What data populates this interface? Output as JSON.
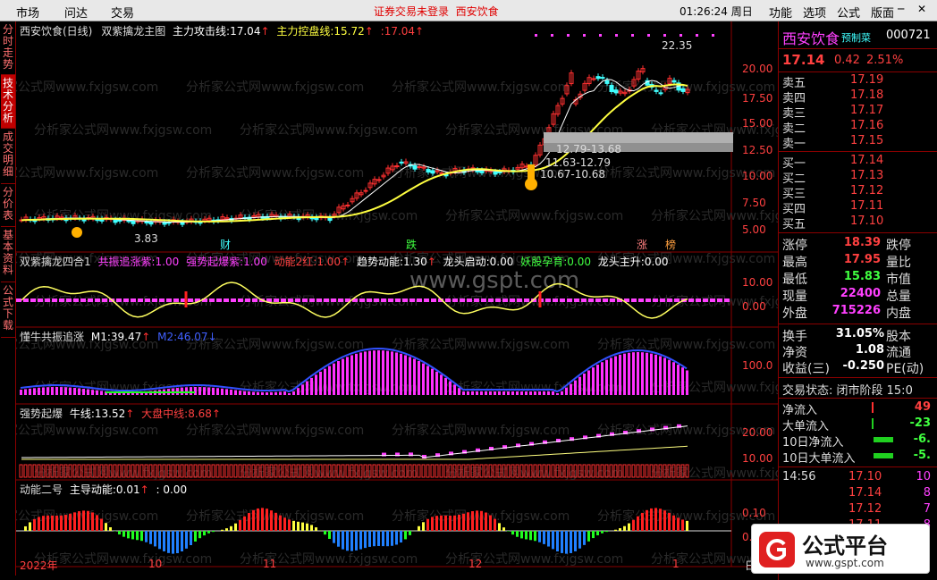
{
  "menubar": {
    "left": [
      "市场",
      "问达",
      "交易"
    ],
    "status": "证券交易未登录",
    "stock": "西安饮食",
    "clock": "01:26:24 周日",
    "right": [
      "功能",
      "选项",
      "公式",
      "版面"
    ],
    "window_buttons": [
      "─",
      "✕"
    ]
  },
  "left_tabs": [
    "分时走势",
    "技术分析",
    "成交明细",
    "分价表",
    "基本资料",
    "公式下载"
  ],
  "panels": {
    "p1": {
      "title": "西安饮食(日线)",
      "ind": "双紫擒龙主图",
      "l1": "主力攻击线:",
      "v1": "17.04",
      "l2": "主力控盘线:",
      "v2": "15.72",
      "v3": "17.04"
    },
    "p2": {
      "ind": "双紫擒龙四合1",
      "l1": "共振追涨紫:",
      "v1": "1.00",
      "l2": "强势起爆紫:",
      "v2": "1.00",
      "l3": "动能2红:",
      "v3": "1.00",
      "l4": "趋势动能:",
      "v4": "1.30",
      "l5": "龙头启动:",
      "v5": "0.00",
      "l6": "妖股孕育:",
      "v6": "0.00",
      "l7": "龙头主升:",
      "v7": "0.00"
    },
    "p3": {
      "ind": "懂牛共振追涨",
      "l1": "M1:",
      "v1": "39.47",
      "l2": "M2:",
      "v2": "46.07"
    },
    "p4": {
      "ind": "强势起爆",
      "l1": "牛线:",
      "v1": "13.52",
      "l2": "大盘中线:",
      "v2": "8.68"
    },
    "p5": {
      "ind": "动能二号",
      "l1": "主导动能:",
      "v1": "0.01",
      "v2": ": 0.00"
    }
  },
  "annotations": {
    "high": "22.35",
    "low": "3.83",
    "b1": "12.79",
    "b2": "13.68",
    "b3": "11.63",
    "b4": "12.79",
    "b5": "10.67",
    "b6": "10.68",
    "cai": "财",
    "die": "跌",
    "zhang": "涨",
    "bang": "榜"
  },
  "axes": {
    "p1": [
      "20.00",
      "17.50",
      "15.00",
      "12.50",
      "10.00",
      "7.50",
      "5.00"
    ],
    "p2": [
      "10.00",
      "0.00"
    ],
    "p3": [
      "100.0"
    ],
    "p4": [
      "20.00",
      "10.00"
    ],
    "p5": [
      "0.10",
      "0.00"
    ],
    "x": [
      "2022年",
      "10",
      "11",
      "12",
      "1"
    ],
    "x_end": "日"
  },
  "watermarks": {
    "site": "www.gspt.com",
    "repeat": "分析家公式网www.fxjgsw.com",
    "logo": "公式平台",
    "logo_url": "www.gspt.com"
  },
  "right_panel": {
    "name": "西安饮食",
    "tag": "预制菜",
    "code": "000721",
    "price": "17.14",
    "change": "0.42",
    "pct": "2.51%",
    "asks": [
      {
        "l": "卖五",
        "p": "17.19"
      },
      {
        "l": "卖四",
        "p": "17.18"
      },
      {
        "l": "卖三",
        "p": "17.17"
      },
      {
        "l": "卖二",
        "p": "17.16"
      },
      {
        "l": "卖一",
        "p": "17.15"
      }
    ],
    "bids": [
      {
        "l": "买一",
        "p": "17.14"
      },
      {
        "l": "买二",
        "p": "17.13"
      },
      {
        "l": "买三",
        "p": "17.12"
      },
      {
        "l": "买四",
        "p": "17.11"
      },
      {
        "l": "买五",
        "p": "17.10"
      }
    ],
    "stats": [
      {
        "l": "涨停",
        "v": "18.39",
        "r": "跌停"
      },
      {
        "l": "最高",
        "v": "17.95",
        "r": "量比"
      },
      {
        "l": "最低",
        "v": "15.83",
        "r": "市值"
      },
      {
        "l": "现量",
        "v": "22400",
        "r": "总量"
      },
      {
        "l": "外盘",
        "v": "715226",
        "r": "内盘"
      }
    ],
    "stats2": [
      {
        "l": "换手",
        "v": "31.05%",
        "r": "股本"
      },
      {
        "l": "净资",
        "v": "1.08",
        "r": "流通"
      },
      {
        "l": "收益(三)",
        "v": "-0.250",
        "r": "PE(动)"
      }
    ],
    "trade_state": "交易状态: 闭市阶段 15:0",
    "flows": [
      {
        "l": "净流入",
        "v": "49"
      },
      {
        "l": "大单流入",
        "v": "-23"
      },
      {
        "l": "10日净流入",
        "v": "-6."
      },
      {
        "l": "10日大单流入",
        "v": "-5."
      }
    ],
    "ticks": [
      {
        "t": "14:56",
        "p": "17.10",
        "v": "10"
      },
      {
        "t": "",
        "p": "17.14",
        "v": "8"
      },
      {
        "t": "",
        "p": "17.12",
        "v": "7"
      },
      {
        "t": "",
        "p": "17.11",
        "v": "8"
      }
    ]
  }
}
